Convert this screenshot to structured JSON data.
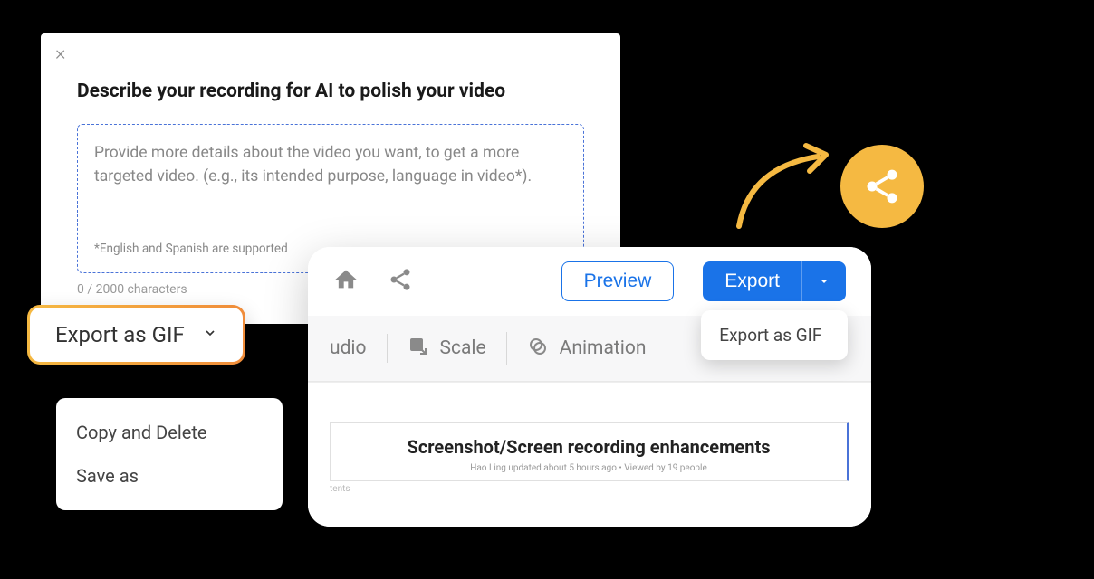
{
  "ai_modal": {
    "title": "Describe your recording for AI to polish your video",
    "placeholder": "Provide more details about the video you want, to get a more targeted video. (e.g., its intended purpose, language in video*).",
    "note": "*English and Spanish are supported",
    "counter": "0 / 2000 characters"
  },
  "export_gif": {
    "label": "Export as GIF"
  },
  "context_menu": {
    "items": [
      "Copy and Delete",
      "Save as"
    ]
  },
  "toolbar": {
    "preview_label": "Preview",
    "export_label": "Export",
    "export_dropdown_item": "Export as GIF",
    "tools": {
      "audio": "udio",
      "scale": "Scale",
      "animation": "Animation"
    }
  },
  "content": {
    "label": "tents",
    "title": "Screenshot/Screen recording enhancements",
    "meta": "Hao Ling updated about 5 hours ago  •  Viewed by 19 people"
  }
}
